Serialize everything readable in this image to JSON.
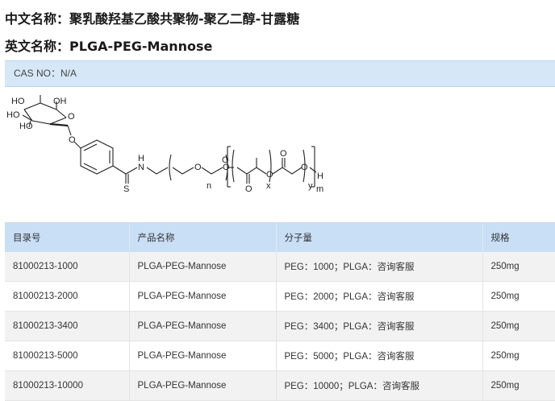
{
  "header": {
    "cn_label": "中文名称：",
    "cn_name": "聚乳酸羟基乙酸共聚物-聚乙二醇-甘露糖",
    "en_label": "英文名称：",
    "en_name": "PLGA-PEG-Mannose"
  },
  "cas": {
    "text": "CAS NO：N/A"
  },
  "structure_labels": {
    "ho1": "HO",
    "oh1": "OH",
    "ho2": "HO",
    "ho3": "HO",
    "o_ring": "O",
    "o_aryl": "O",
    "s": "S",
    "nh_n": "N",
    "nh_h": "H",
    "o_peg1": "O",
    "o_peg2": "O",
    "n_sub": "n",
    "o_link": "O",
    "o_carbonyl1": "O",
    "o_ester": "O",
    "x_sub": "x",
    "o_carbonyl2": "O",
    "o_end": "O",
    "h_end": "H",
    "y_sub": "y",
    "m_sub": "m"
  },
  "table": {
    "headers": [
      "目录号",
      "产品名称",
      "分子量",
      "规格"
    ],
    "rows": [
      [
        "81000213-1000",
        "PLGA-PEG-Mannose",
        "PEG：1000；PLGA：咨询客服",
        "250mg"
      ],
      [
        "81000213-2000",
        "PLGA-PEG-Mannose",
        "PEG：2000；PLGA：咨询客服",
        "250mg"
      ],
      [
        "81000213-3400",
        "PLGA-PEG-Mannose",
        "PEG：3400；PLGA：咨询客服",
        "250mg"
      ],
      [
        "81000213-5000",
        "PLGA-PEG-Mannose",
        "PEG：5000；PLGA：咨询客服",
        "250mg"
      ],
      [
        "81000213-10000",
        "PLGA-PEG-Mannose",
        "PEG：10000；PLGA：咨询客服",
        "250mg"
      ]
    ]
  }
}
